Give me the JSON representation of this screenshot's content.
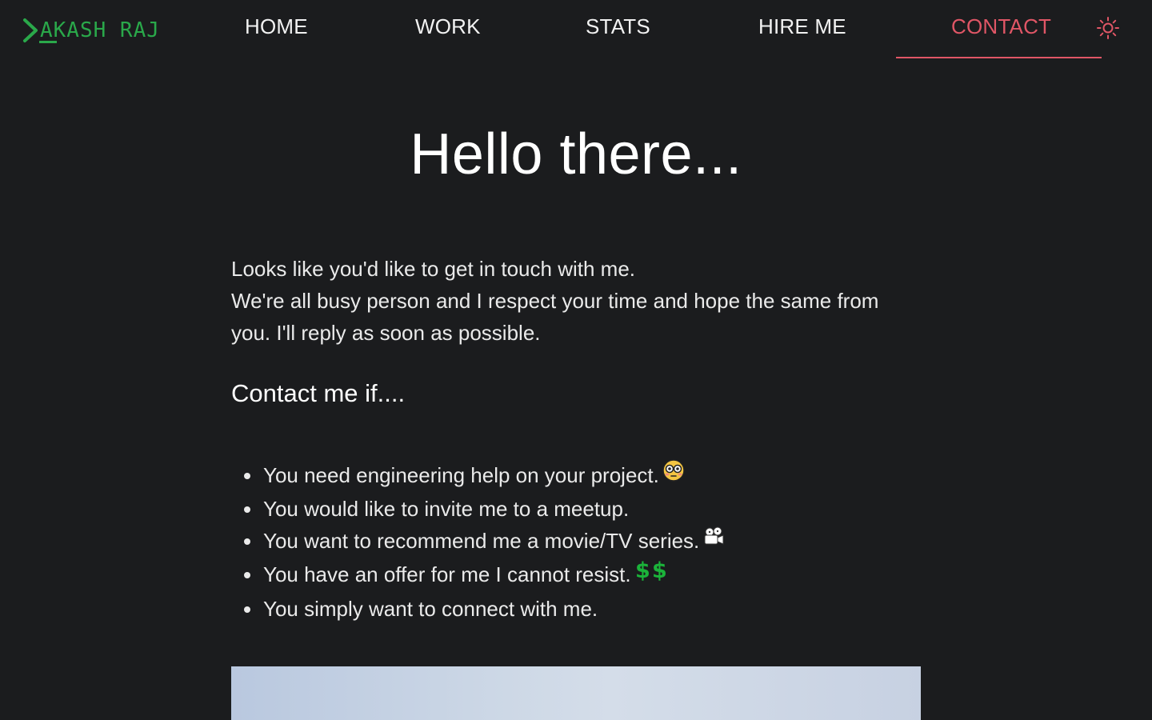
{
  "brand": {
    "name": "AKASH RAJ",
    "color": "#2aa84a"
  },
  "nav": {
    "items": [
      {
        "label": "HOME",
        "active": false
      },
      {
        "label": "WORK",
        "active": false
      },
      {
        "label": "STATS",
        "active": false
      },
      {
        "label": "HIRE ME",
        "active": false
      },
      {
        "label": "CONTACT",
        "active": true
      }
    ],
    "active_color": "#e05666",
    "theme_toggle_icon": "sun-icon"
  },
  "hero": {
    "title": "Hello there..."
  },
  "intro": {
    "line1": "Looks like you'd like to get in touch with me.",
    "line2": "We're all busy person and I respect your time and hope the same from you. I'll reply as soon as possible."
  },
  "contact_section": {
    "heading": "Contact me if....",
    "reasons": [
      {
        "text": "You need engineering help on your project.",
        "emoji": "flushed-face-icon"
      },
      {
        "text": "You would like to invite me to a meetup.",
        "emoji": ""
      },
      {
        "text": "You want to recommend me a movie/TV series.",
        "emoji": "movie-camera-icon"
      },
      {
        "text": "You have an offer for me I cannot resist.",
        "emoji": "dollar-signs-icon"
      },
      {
        "text": "You simply want to connect with me.",
        "emoji": ""
      }
    ]
  },
  "colors": {
    "background": "#1b1c1e",
    "text": "#f2f2f2"
  }
}
